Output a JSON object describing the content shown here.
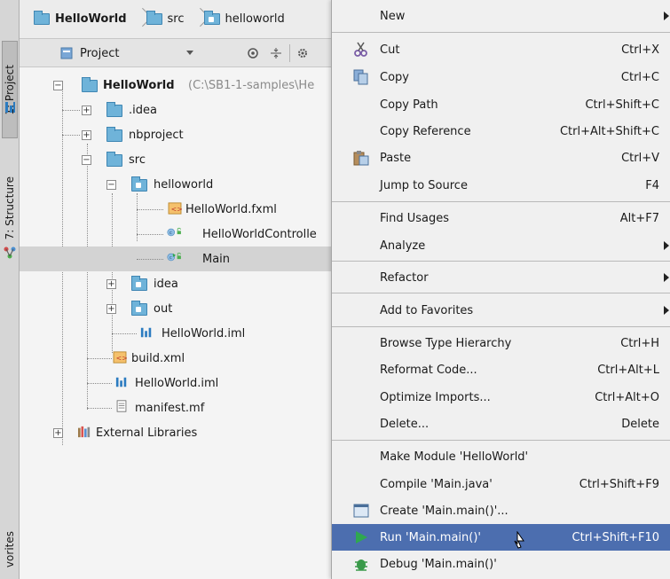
{
  "left_strip": {
    "project_tab": "1: Project",
    "structure_tab": "7: Structure",
    "favorites_tab": "vorites"
  },
  "breadcrumb": [
    "HelloWorld",
    "src",
    "helloworld"
  ],
  "project_toolbar": {
    "view_label": "Project"
  },
  "tree": {
    "root_label": "HelloWorld",
    "root_path": "(C:\\SB1-1-samples\\He",
    "items": [
      ".idea",
      "nbproject",
      "src",
      "helloworld",
      "HelloWorld.fxml",
      "HelloWorldControlle",
      "Main",
      "idea",
      "out",
      "HelloWorld.iml",
      "build.xml",
      "HelloWorld.iml",
      "manifest.mf",
      "External Libraries"
    ]
  },
  "menu": {
    "new": "New",
    "cut": "Cut",
    "cut_sc": "Ctrl+X",
    "copy": "Copy",
    "copy_sc": "Ctrl+C",
    "copy_path": "Copy Path",
    "copy_path_sc": "Ctrl+Shift+C",
    "copy_ref": "Copy Reference",
    "copy_ref_sc": "Ctrl+Alt+Shift+C",
    "paste": "Paste",
    "paste_sc": "Ctrl+V",
    "jump": "Jump to Source",
    "jump_sc": "F4",
    "find_usages": "Find Usages",
    "find_usages_sc": "Alt+F7",
    "analyze": "Analyze",
    "refactor": "Refactor",
    "favorites": "Add to Favorites",
    "browse": "Browse Type Hierarchy",
    "browse_sc": "Ctrl+H",
    "reformat": "Reformat Code...",
    "reformat_sc": "Ctrl+Alt+L",
    "optimize": "Optimize Imports...",
    "optimize_sc": "Ctrl+Alt+O",
    "delete": "Delete...",
    "delete_sc": "Delete",
    "make_module": "Make Module 'HelloWorld'",
    "compile": "Compile 'Main.java'",
    "compile_sc": "Ctrl+Shift+F9",
    "create": "Create 'Main.main()'...",
    "run": "Run 'Main.main()'",
    "run_sc": "Ctrl+Shift+F10",
    "debug": "Debug 'Main.main()'"
  },
  "colors": {
    "highlight": "#4c6eaf",
    "folder": "#6fb3d9",
    "run_green": "#2fa84f"
  }
}
